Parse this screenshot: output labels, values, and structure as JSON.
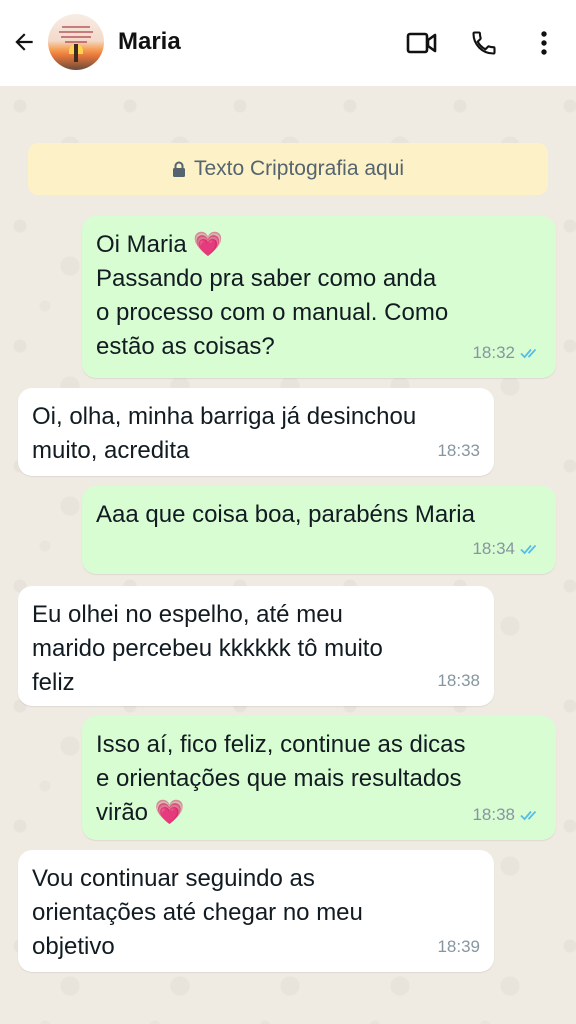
{
  "header": {
    "contact_name": "Maria",
    "icons": [
      "back-arrow-icon",
      "avatar",
      "video-call-icon",
      "phone-icon",
      "more-vert-icon"
    ]
  },
  "encryption_notice": "Texto Criptografia aqui",
  "messages": [
    {
      "direction": "out",
      "text": "Oi Maria 💗\nPassando pra saber como anda\no processo com o manual. Como\nestão as coisas?",
      "time": "18:32",
      "status": "read"
    },
    {
      "direction": "in",
      "text": "Oi, olha, minha barriga já desinchou\nmuito, acredita",
      "time": "18:33"
    },
    {
      "direction": "out",
      "text": "Aaa que coisa boa, parabéns Maria",
      "time": "18:34",
      "status": "read"
    },
    {
      "direction": "in",
      "text": "Eu olhei no espelho, até meu\nmarido percebeu kkkkkk tô muito\nfeliz",
      "time": "18:38"
    },
    {
      "direction": "out",
      "text": "Isso aí, fico feliz, continue as dicas\ne orientações que mais resultados\nvirão 💗",
      "time": "18:38",
      "status": "read"
    },
    {
      "direction": "in",
      "text": "Vou continuar seguindo as\norientações até chegar no meu\nobjetivo",
      "time": "18:39"
    }
  ],
  "colors": {
    "outgoing_bubble": "#d9fdd3",
    "incoming_bubble": "#ffffff",
    "chat_background": "#efeae2",
    "read_ticks": "#53bdeb",
    "encryption_banner": "#fdf1c7"
  }
}
